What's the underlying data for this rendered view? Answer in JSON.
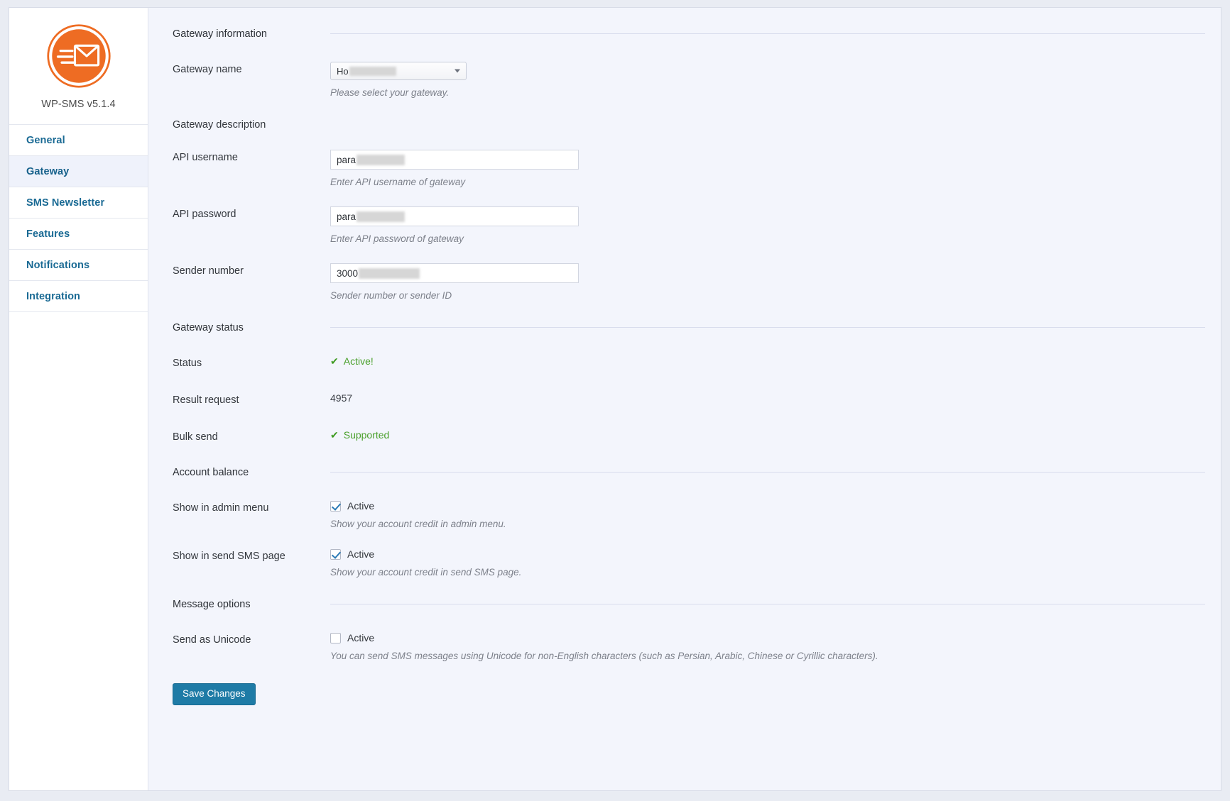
{
  "sidebar": {
    "logo_icon": "envelope-speed-icon",
    "brand_title": "WP-SMS v5.1.4",
    "items": [
      {
        "label": "General",
        "active": false
      },
      {
        "label": "Gateway",
        "active": true
      },
      {
        "label": "SMS Newsletter",
        "active": false
      },
      {
        "label": "Features",
        "active": false
      },
      {
        "label": "Notifications",
        "active": false
      },
      {
        "label": "Integration",
        "active": false
      }
    ]
  },
  "sections": {
    "gateway_information": "Gateway information",
    "gateway_status": "Gateway status",
    "account_balance": "Account balance",
    "message_options": "Message options"
  },
  "fields": {
    "gateway_name": {
      "label": "Gateway name",
      "value": "Ho",
      "value_redacted": true,
      "help": "Please select your gateway.",
      "dropdown_icon": "chevron-down-icon"
    },
    "gateway_description": {
      "label": "Gateway description",
      "value": ""
    },
    "api_username": {
      "label": "API username",
      "value": "para",
      "value_redacted": true,
      "help": "Enter API username of gateway"
    },
    "api_password": {
      "label": "API password",
      "value": "para",
      "value_redacted": true,
      "help": "Enter API password of gateway"
    },
    "sender_number": {
      "label": "Sender number",
      "value": "3000",
      "value_redacted": true,
      "help": "Sender number or sender ID"
    },
    "status": {
      "label": "Status",
      "value": "Active!",
      "check_icon": "check-icon"
    },
    "result_request": {
      "label": "Result request",
      "value": "4957"
    },
    "bulk_send": {
      "label": "Bulk send",
      "value": "Supported",
      "check_icon": "check-icon"
    },
    "show_in_admin_menu": {
      "label": "Show in admin menu",
      "checkbox_label": "Active",
      "checked": true,
      "help": "Show your account credit in admin menu."
    },
    "show_in_send_sms_page": {
      "label": "Show in send SMS page",
      "checkbox_label": "Active",
      "checked": true,
      "help": "Show your account credit in send SMS page."
    },
    "send_as_unicode": {
      "label": "Send as Unicode",
      "checkbox_label": "Active",
      "checked": false,
      "help": "You can send SMS messages using Unicode for non-English characters (such as Persian, Arabic, Chinese or Cyrillic characters)."
    }
  },
  "actions": {
    "save_label": "Save Changes"
  },
  "colors": {
    "accent_link": "#1a6a94",
    "logo_orange": "#ee6c23",
    "status_green": "#4aa02c",
    "button_blue": "#1e7ba6",
    "active_nav_bg": "#eff2fb",
    "page_bg": "#f3f5fc"
  }
}
